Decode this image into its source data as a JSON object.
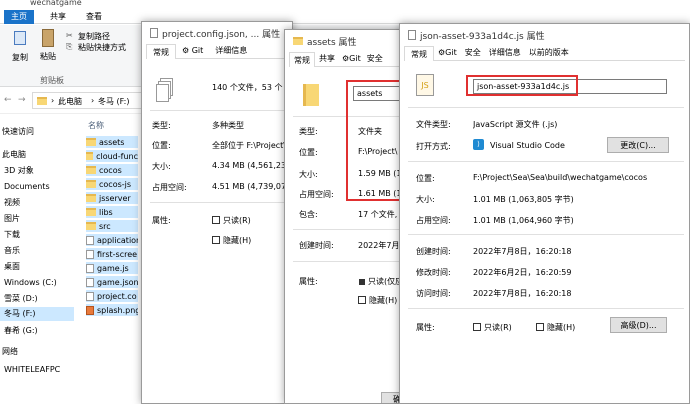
{
  "explorer": {
    "title": "wechatgame",
    "ribbon_tabs": [
      "主页",
      "共享",
      "查看"
    ],
    "ribbon": {
      "copy": "复制",
      "paste": "粘贴",
      "copy_path": "复制路径",
      "paste_shortcut": "粘贴快捷方式",
      "clipboard": "剪贴板"
    },
    "breadcrumb": [
      "此电脑",
      "冬马 (F:)"
    ],
    "column_name": "名称",
    "nav": [
      "快速访问",
      "此电脑",
      "3D 对象",
      "Documents",
      "视频",
      "图片",
      "下载",
      "音乐",
      "桌面",
      "Windows (C:)",
      "雪菜 (D:)",
      "冬马 (F:)",
      "春希 (G:)",
      "网络",
      "WHITELEAFPC"
    ],
    "files": [
      "assets",
      "cloud-func",
      "cocos",
      "cocos-js",
      "jsserver",
      "libs",
      "src",
      "application",
      "first-scree",
      "game.js",
      "game.json",
      "project.co",
      "splash.png"
    ]
  },
  "win1": {
    "title": "project.config.json, ... 属性",
    "tabs": [
      "常规",
      "Git",
      "详细信息"
    ],
    "summary": "140 个文件，53 个",
    "type_label": "类型:",
    "type_value": "多种类型",
    "location_label": "位置:",
    "location_value": "全部位于 F:\\Project\\",
    "size_label": "大小:",
    "size_value": "4.34 MB (4,561,238",
    "disk_label": "占用空间:",
    "disk_value": "4.51 MB (4,739,072",
    "attr_label": "属性:",
    "readonly": "只读(R)",
    "hidden": "隐藏(H)"
  },
  "win2": {
    "title": "assets 属性",
    "tabs": [
      "常规",
      "共享",
      "Git",
      "安全"
    ],
    "name_value": "assets",
    "type_label": "类型:",
    "type_value": "文件夹",
    "location_label": "位置:",
    "location_value": "F:\\Project\\",
    "size_label": "大小:",
    "size_value": "1.59 MB (1",
    "disk_label": "占用空间:",
    "disk_value": "1.61 MB (1",
    "contains_label": "包含:",
    "contains_value": "17 个文件,",
    "created_label": "创建时间:",
    "created_value": "2022年7月8",
    "attr_label": "属性:",
    "readonly": "只读(仅应",
    "hidden": "隐藏(H)",
    "bottom_btn": "确"
  },
  "win3": {
    "title": "json-asset-933a1d4c.js 属性",
    "tabs": [
      "常规",
      "Git",
      "安全",
      "详细信息",
      "以前的版本"
    ],
    "file_icon_text": "JS",
    "name_value": "json-asset-933a1d4c.js",
    "type_label": "文件类型:",
    "type_value": "JavaScript 源文件 (.js)",
    "opens_label": "打开方式:",
    "opens_value": "Visual Studio Code",
    "change_btn": "更改(C)...",
    "location_label": "位置:",
    "location_value": "F:\\Project\\Sea\\Sea\\build\\wechatgame\\cocos",
    "size_label": "大小:",
    "size_value": "1.01 MB (1,063,805 字节)",
    "disk_label": "占用空间:",
    "disk_value": "1.01 MB (1,064,960 字节)",
    "created_label": "创建时间:",
    "created_value": "2022年7月8日，16:20:18",
    "modified_label": "修改时间:",
    "modified_value": "2022年6月2日，16:20:59",
    "accessed_label": "访问时间:",
    "accessed_value": "2022年7月8日，16:20:18",
    "attr_label": "属性:",
    "readonly": "只读(R)",
    "hidden": "隐藏(H)",
    "advanced_btn": "高级(D)..."
  }
}
